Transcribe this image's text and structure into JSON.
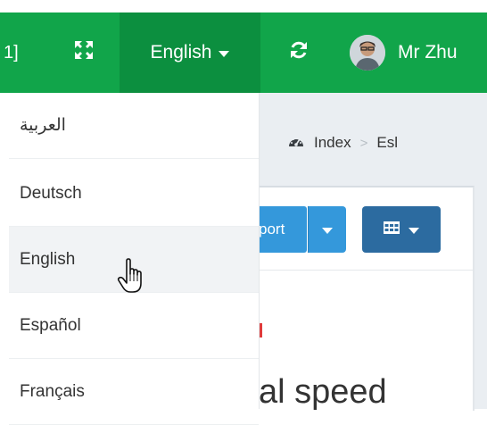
{
  "navbar": {
    "bracket_text": "1]",
    "language_label": "English",
    "user_name": "Mr Zhu",
    "icons": {
      "expand": "expand-icon",
      "refresh": "refresh-icon",
      "caret": "caret-down-icon",
      "avatar": "avatar"
    },
    "colors": {
      "navbar_bg": "#11a54a",
      "active_bg": "#0c8f3f"
    }
  },
  "language_menu": {
    "items": [
      "العربية",
      "Deutsch",
      "English",
      "Español",
      "Français"
    ],
    "hovered": "English"
  },
  "breadcrumb": {
    "home_icon": "dashboard-icon",
    "items": [
      "Index",
      "Esl"
    ],
    "separator": ">"
  },
  "toolbar": {
    "export_label": "port",
    "export_color": "#3498db",
    "columns_icon": "grid-icon",
    "columns_color": "#2c6ba0"
  },
  "main": {
    "partial_heading": "al speed"
  }
}
